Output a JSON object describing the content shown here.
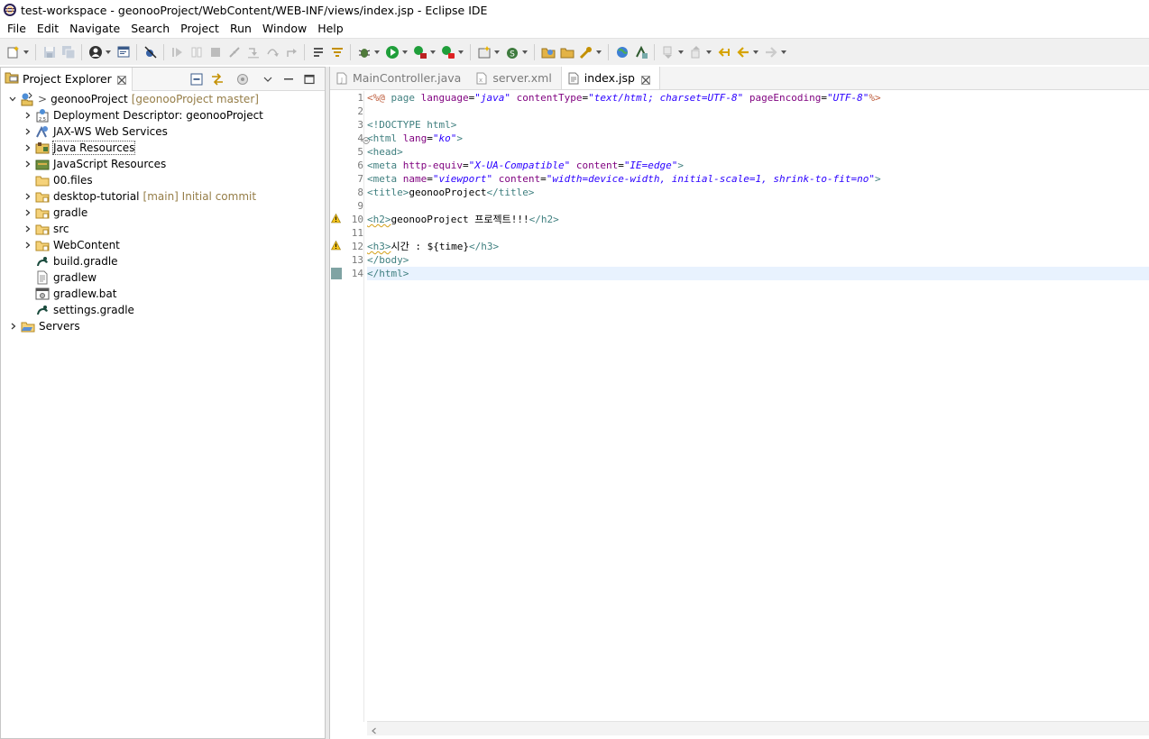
{
  "window": {
    "title": "test-workspace - geonooProject/WebContent/WEB-INF/views/index.jsp - Eclipse IDE"
  },
  "menubar": {
    "items": [
      "File",
      "Edit",
      "Navigate",
      "Search",
      "Project",
      "Run",
      "Window",
      "Help"
    ]
  },
  "toolbar": {
    "icons": [
      "new-wizard-icon",
      "save-icon",
      "save-all-icon",
      "profile-icon",
      "open-console-icon",
      "skip-breakpoints-icon",
      "resume-icon",
      "suspend-icon",
      "terminate-icon",
      "disconnect-icon",
      "step-into-icon",
      "step-over-icon",
      "step-return-icon",
      "drop-to-frame-icon",
      "use-step-filters-icon",
      "debug-icon",
      "run-icon",
      "coverage-icon",
      "external-tools-icon",
      "new-server-icon",
      "new-java-class-icon",
      "open-type-icon",
      "open-task-icon",
      "search-icon",
      "web-browser-icon",
      "toggle-mark-occurrences-icon",
      "next-annotation-icon",
      "previous-annotation-icon",
      "last-edit-location-icon",
      "back-icon",
      "forward-icon"
    ]
  },
  "explorer": {
    "tab_label": "Project Explorer",
    "tree": [
      {
        "label": "geonooProject",
        "prefix": ">",
        "decoration": "[geonooProject master]",
        "icon": "web-project-icon",
        "expanded": true,
        "level": 0
      },
      {
        "label": "Deployment Descriptor: geonooProject",
        "icon": "deployment-descriptor-icon",
        "expanded": false,
        "level": 1
      },
      {
        "label": "JAX-WS Web Services",
        "icon": "web-services-icon",
        "expanded": false,
        "level": 1
      },
      {
        "label": "Java Resources",
        "icon": "java-resources-icon",
        "expanded": false,
        "level": 1,
        "selected": true
      },
      {
        "label": "JavaScript Resources",
        "icon": "javascript-resources-icon",
        "expanded": false,
        "level": 1
      },
      {
        "label": "00.files",
        "icon": "folder-icon",
        "leaf": true,
        "level": 1
      },
      {
        "label": "desktop-tutorial",
        "decoration": "[main] Initial commit",
        "icon": "git-folder-icon",
        "expanded": false,
        "level": 1
      },
      {
        "label": "gradle",
        "icon": "git-folder-icon",
        "expanded": false,
        "level": 1
      },
      {
        "label": "src",
        "icon": "git-folder-icon",
        "expanded": false,
        "level": 1
      },
      {
        "label": "WebContent",
        "icon": "git-folder-icon",
        "expanded": false,
        "level": 1
      },
      {
        "label": "build.gradle",
        "icon": "gradle-file-icon",
        "leaf": true,
        "level": 1
      },
      {
        "label": "gradlew",
        "icon": "text-file-icon",
        "leaf": true,
        "level": 1
      },
      {
        "label": "gradlew.bat",
        "icon": "bat-file-icon",
        "leaf": true,
        "level": 1
      },
      {
        "label": "settings.gradle",
        "icon": "gradle-file-icon",
        "leaf": true,
        "level": 1
      },
      {
        "label": "Servers",
        "icon": "servers-folder-icon",
        "expanded": false,
        "level": 0
      }
    ]
  },
  "editor": {
    "tabs": [
      {
        "label": "MainController.java",
        "icon": "java-file-icon",
        "active": false
      },
      {
        "label": "server.xml",
        "icon": "xml-file-icon",
        "active": false
      },
      {
        "label": "index.jsp",
        "icon": "jsp-file-icon",
        "active": true
      }
    ],
    "lines": [
      {
        "n": "1",
        "tokens": [
          [
            "jsp",
            "<%@ "
          ],
          [
            "tag",
            "page "
          ],
          [
            "attr",
            "language"
          ],
          [
            "txt",
            "="
          ],
          [
            "val",
            "\"java\""
          ],
          [
            "txt",
            " "
          ],
          [
            "attr",
            "contentType"
          ],
          [
            "txt",
            "="
          ],
          [
            "val",
            "\"text/html; charset=UTF-8\""
          ],
          [
            "txt",
            " "
          ],
          [
            "attr",
            "pageEncoding"
          ],
          [
            "txt",
            "="
          ],
          [
            "val",
            "\"UTF-8\""
          ],
          [
            "jsp",
            "%>"
          ]
        ]
      },
      {
        "n": "2",
        "tokens": []
      },
      {
        "n": "3",
        "tokens": [
          [
            "tag",
            "<!DOCTYPE html>"
          ]
        ]
      },
      {
        "n": "4",
        "fold": true,
        "tokens": [
          [
            "tag",
            "<html "
          ],
          [
            "attr",
            "lang"
          ],
          [
            "txt",
            "="
          ],
          [
            "val",
            "\"ko\""
          ],
          [
            "tag",
            ">"
          ]
        ]
      },
      {
        "n": "5",
        "tokens": [
          [
            "tag",
            "<head>"
          ]
        ]
      },
      {
        "n": "6",
        "tokens": [
          [
            "tag",
            "<meta "
          ],
          [
            "attr",
            "http-equiv"
          ],
          [
            "txt",
            "="
          ],
          [
            "val",
            "\"X-UA-Compatible\""
          ],
          [
            "txt",
            " "
          ],
          [
            "attr",
            "content"
          ],
          [
            "txt",
            "="
          ],
          [
            "val",
            "\"IE=edge\""
          ],
          [
            "tag",
            ">"
          ]
        ]
      },
      {
        "n": "7",
        "tokens": [
          [
            "tag",
            "<meta "
          ],
          [
            "attr",
            "name"
          ],
          [
            "txt",
            "="
          ],
          [
            "val",
            "\"viewport\""
          ],
          [
            "txt",
            " "
          ],
          [
            "attr",
            "content"
          ],
          [
            "txt",
            "="
          ],
          [
            "val",
            "\"width=device-width, initial-scale=1, shrink-to-fit=no\""
          ],
          [
            "tag",
            ">"
          ]
        ]
      },
      {
        "n": "8",
        "tokens": [
          [
            "tag",
            "<title>"
          ],
          [
            "txt",
            "geonooProject"
          ],
          [
            "tag",
            "</title>"
          ]
        ]
      },
      {
        "n": "9",
        "tokens": []
      },
      {
        "n": "10",
        "warn": true,
        "tokens": [
          [
            "tag warn-under",
            "<h2>"
          ],
          [
            "txt",
            "geonooProject 프로젝트!!!"
          ],
          [
            "tag",
            "</h2>"
          ]
        ]
      },
      {
        "n": "11",
        "tokens": []
      },
      {
        "n": "12",
        "warn": true,
        "tokens": [
          [
            "tag warn-under",
            "<h3>"
          ],
          [
            "txt",
            "시간 : ${time}"
          ],
          [
            "tag",
            "</h3>"
          ]
        ]
      },
      {
        "n": "13",
        "tokens": [
          [
            "tag",
            "</body>"
          ]
        ]
      },
      {
        "n": "14",
        "current": true,
        "tokens": [
          [
            "tag",
            "</html>"
          ]
        ]
      }
    ]
  }
}
